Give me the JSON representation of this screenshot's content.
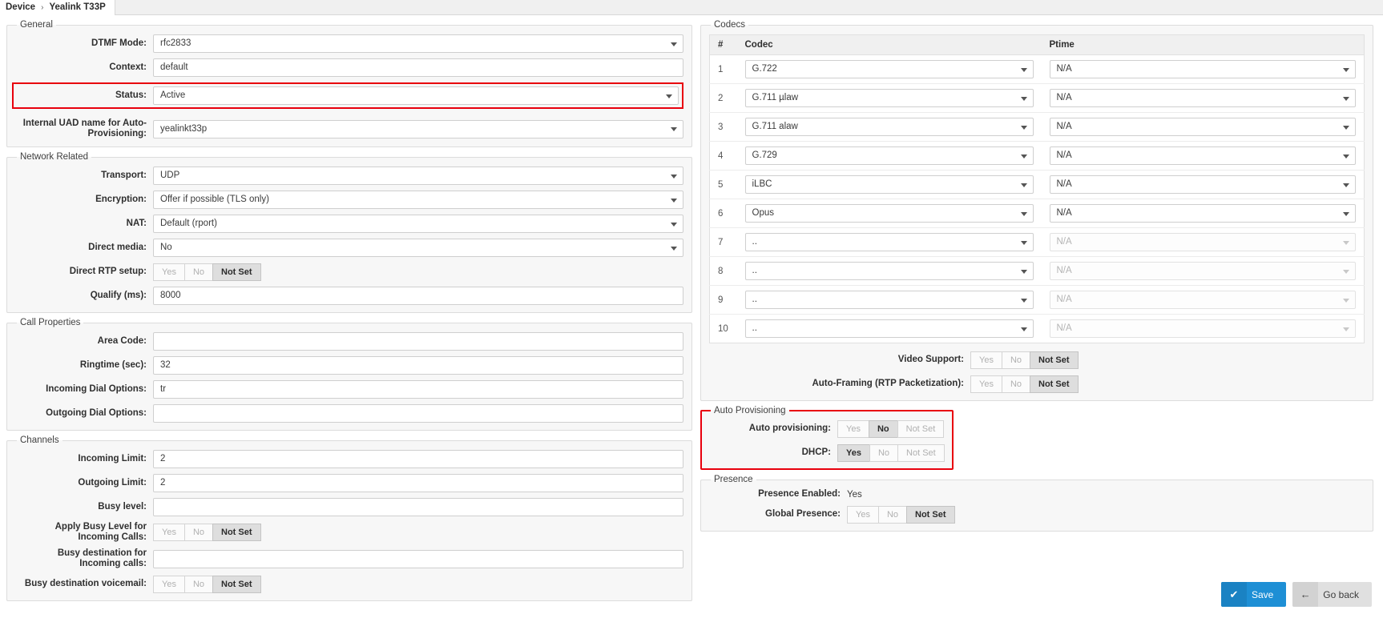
{
  "breadcrumb": {
    "root": "Device",
    "separator": "›",
    "current": "Yealink T33P"
  },
  "colors": {
    "accent": "#1e8fd5",
    "highlight": "#e8000d"
  },
  "general": {
    "legend": "General",
    "dtmf_mode": {
      "label": "DTMF Mode:",
      "value": "rfc2833"
    },
    "context": {
      "label": "Context:",
      "value": "default"
    },
    "status": {
      "label": "Status:",
      "value": "Active"
    },
    "uad_name": {
      "label": "Internal UAD name for Auto-Provisioning:",
      "value": "yealinkt33p"
    }
  },
  "network": {
    "legend": "Network Related",
    "transport": {
      "label": "Transport:",
      "value": "UDP"
    },
    "encryption": {
      "label": "Encryption:",
      "value": "Offer if possible (TLS only)"
    },
    "nat": {
      "label": "NAT:",
      "value": "Default (rport)"
    },
    "direct_media": {
      "label": "Direct media:",
      "value": "No"
    },
    "direct_rtp": {
      "label": "Direct RTP setup:",
      "selected": "Not Set"
    },
    "qualify": {
      "label": "Qualify (ms):",
      "value": "8000"
    }
  },
  "call_properties": {
    "legend": "Call Properties",
    "area_code": {
      "label": "Area Code:",
      "value": ""
    },
    "ringtime": {
      "label": "Ringtime (sec):",
      "value": "32"
    },
    "incoming_dial_options": {
      "label": "Incoming Dial Options:",
      "value": "tr"
    },
    "outgoing_dial_options": {
      "label": "Outgoing Dial Options:",
      "value": ""
    }
  },
  "channels": {
    "legend": "Channels",
    "incoming_limit": {
      "label": "Incoming Limit:",
      "value": "2"
    },
    "outgoing_limit": {
      "label": "Outgoing Limit:",
      "value": "2"
    },
    "busy_level": {
      "label": "Busy level:",
      "value": ""
    },
    "apply_busy_level": {
      "label": "Apply Busy Level for Incoming Calls:",
      "selected": "Not Set"
    },
    "busy_destination": {
      "label": "Busy destination for Incoming calls:",
      "value": ""
    },
    "busy_voicemail": {
      "label": "Busy destination voicemail:",
      "selected": "Not Set"
    }
  },
  "codecs": {
    "legend": "Codecs",
    "headers": {
      "num": "#",
      "codec": "Codec",
      "ptime": "Ptime"
    },
    "rows": [
      {
        "num": "1",
        "codec": "G.722",
        "ptime": "N/A",
        "disabled": false
      },
      {
        "num": "2",
        "codec": "G.711 µlaw",
        "ptime": "N/A",
        "disabled": false
      },
      {
        "num": "3",
        "codec": "G.711 alaw",
        "ptime": "N/A",
        "disabled": false
      },
      {
        "num": "4",
        "codec": "G.729",
        "ptime": "N/A",
        "disabled": false
      },
      {
        "num": "5",
        "codec": "iLBC",
        "ptime": "N/A",
        "disabled": false
      },
      {
        "num": "6",
        "codec": "Opus",
        "ptime": "N/A",
        "disabled": false
      },
      {
        "num": "7",
        "codec": "..",
        "ptime": "N/A",
        "disabled": true
      },
      {
        "num": "8",
        "codec": "..",
        "ptime": "N/A",
        "disabled": true
      },
      {
        "num": "9",
        "codec": "..",
        "ptime": "N/A",
        "disabled": true
      },
      {
        "num": "10",
        "codec": "..",
        "ptime": "N/A",
        "disabled": true
      }
    ],
    "video_support": {
      "label": "Video Support:",
      "selected": "Not Set"
    },
    "auto_framing": {
      "label": "Auto-Framing (RTP Packetization):",
      "selected": "Not Set"
    }
  },
  "auto_provisioning": {
    "legend": "Auto Provisioning",
    "auto_provisioning": {
      "label": "Auto provisioning:",
      "selected": "No"
    },
    "dhcp": {
      "label": "DHCP:",
      "selected": "Yes"
    }
  },
  "presence": {
    "legend": "Presence",
    "presence_enabled": {
      "label": "Presence Enabled:",
      "value": "Yes"
    },
    "global_presence": {
      "label": "Global Presence:",
      "selected": "Not Set"
    }
  },
  "tri_options": {
    "yes": "Yes",
    "no": "No",
    "not_set": "Not Set"
  },
  "footer": {
    "save": {
      "label": "Save",
      "icon": "check-icon",
      "glyph": "✔"
    },
    "go_back": {
      "label": "Go back",
      "icon": "arrow-left-icon",
      "glyph": "←"
    }
  }
}
